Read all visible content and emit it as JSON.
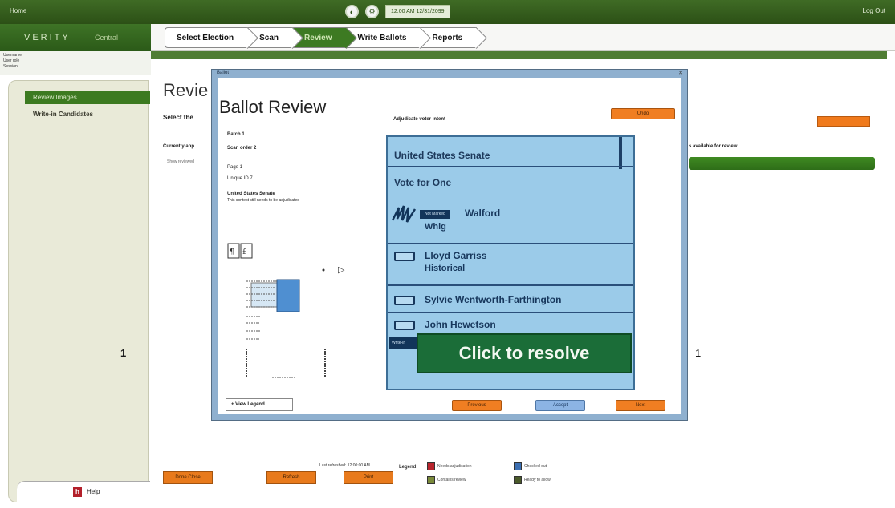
{
  "topbar": {
    "home": "Home",
    "datetime": "12:00 AM 12/31/2099",
    "logout": "Log Out"
  },
  "brand": {
    "product": "VERITY",
    "module": "Central"
  },
  "nav": {
    "steps": [
      "Select Election",
      "Scan",
      "Review",
      "Write Ballots",
      "Reports"
    ],
    "active_index": 2
  },
  "user_info": [
    "Username",
    "User role",
    "Session"
  ],
  "sidebar": {
    "items": [
      "Review Images",
      "Write-in Candidates"
    ],
    "active_index": 0,
    "help": "Help"
  },
  "background_page": {
    "title": "Revie",
    "subtitle": "Select the ",
    "currently": "Currently app",
    "checkbox_label": "Show reviewed",
    "available_text": "s available for review",
    "left_number": "1",
    "right_number": "1"
  },
  "bottom": {
    "btn_left": "Done Close",
    "btn_mid": "Refresh",
    "btn_third": "Print",
    "last_refreshed": "Last refreshed: 12:00:00 AM",
    "legend_title": "Legend:",
    "legend": [
      {
        "label": "Needs adjudication",
        "color": "#b8242d"
      },
      {
        "label": "Checked out",
        "color": "#3c6fb2"
      },
      {
        "label": "Contains review",
        "color": "#7a8a3a"
      },
      {
        "label": "Ready to allow",
        "color": "#4a5a2a"
      }
    ]
  },
  "dialog": {
    "window_title": "Ballot",
    "title": "Ballot Review",
    "batch": "Batch 1",
    "scan_order": "Scan order 2",
    "page": "Page 1",
    "unique_id": "Unique ID 7",
    "contest_name": "United States Senate",
    "contest_note": "This contest still needs to be adjudicated",
    "adjudicate_label": "Adjudicate voter intent",
    "top_button": "Undo",
    "view_legend": "View Legend",
    "buttons": {
      "previous": "Previous",
      "accept": "Accept",
      "next": "Next"
    },
    "ballot": {
      "contest": "United States Senate",
      "vote_for": "Vote for One",
      "not_marked": "Not Marked",
      "candidates": [
        {
          "name": "Walford",
          "party": "Whig"
        },
        {
          "name": "Lloyd Garriss",
          "party": "Historical"
        },
        {
          "name": "Sylvie Wentworth-Farthington",
          "party": ""
        },
        {
          "name": "John Hewetson",
          "party": ""
        }
      ],
      "more_tag": "Write-in",
      "resolve_button": "Click to resolve"
    }
  }
}
